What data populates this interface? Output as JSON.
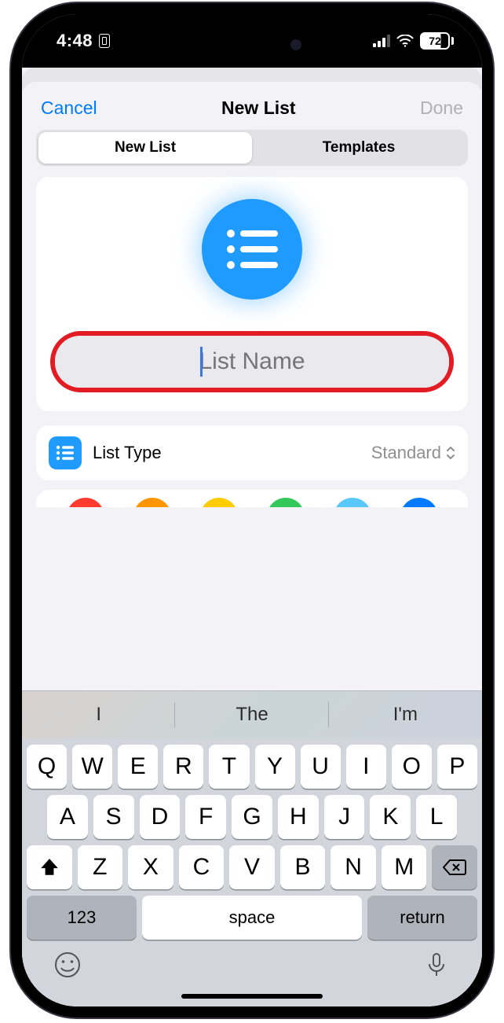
{
  "status": {
    "time": "4:48",
    "battery": "72"
  },
  "nav": {
    "cancel": "Cancel",
    "title": "New List",
    "done": "Done"
  },
  "segmented": {
    "new_list": "New List",
    "templates": "Templates",
    "active": 0
  },
  "list_form": {
    "name_value": "",
    "name_placeholder": "List Name",
    "icon_color": "#1f9bff"
  },
  "list_type": {
    "label": "List Type",
    "value": "Standard"
  },
  "color_options": [
    "#ff3b30",
    "#ff9500",
    "#ffcc00",
    "#34c759",
    "#5ac8fa",
    "#007aff"
  ],
  "predictions": [
    "I",
    "The",
    "I'm"
  ],
  "keyboard": {
    "row1": [
      "Q",
      "W",
      "E",
      "R",
      "T",
      "Y",
      "U",
      "I",
      "O",
      "P"
    ],
    "row2": [
      "A",
      "S",
      "D",
      "F",
      "G",
      "H",
      "J",
      "K",
      "L"
    ],
    "row3": [
      "Z",
      "X",
      "C",
      "V",
      "B",
      "N",
      "M"
    ],
    "numkey": "123",
    "space": "space",
    "return": "return"
  }
}
